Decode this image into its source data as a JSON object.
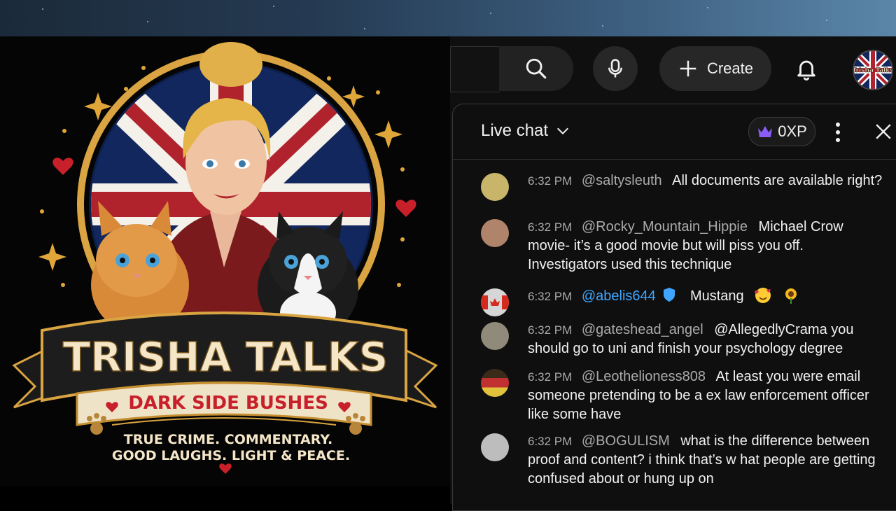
{
  "artwork": {
    "title": "TRISHA TALKS",
    "subtitle": "DARK SIDE BUSHES",
    "tagline_1": "TRUE CRIME. COMMENTARY.",
    "tagline_2": "GOOD LAUGHS. LIGHT & PEACE."
  },
  "header": {
    "create_label": "Create",
    "avatar_text": "Trisha Talks"
  },
  "icons": {
    "search": "search-icon",
    "mic": "mic-icon",
    "plus": "plus-icon",
    "bell": "bell-icon",
    "chevron": "chevron-down-icon",
    "crown": "crown-icon",
    "more": "more-vert-icon",
    "close": "close-icon",
    "verified": "verified-shield-icon"
  },
  "chat": {
    "title": "Live chat",
    "xp_label": "0XP",
    "messages": [
      {
        "time": "6:32 PM",
        "author": "@saltysleuth",
        "text": "All documents are available right?",
        "avatar_color": "#c9b56a"
      },
      {
        "time": "6:32 PM",
        "author": "@Rocky_Mountain_Hippie",
        "text": "Michael Crow movie- it’s a good movie but will piss you off. Investigators used this technique",
        "avatar_color": "#b0846a"
      },
      {
        "time": "6:32 PM",
        "author": "@abelis644",
        "text": "Mustang",
        "avatar_color": "#d6d6d6",
        "verified": true
      },
      {
        "time": "6:32 PM",
        "author": "@gateshead_angel",
        "text": "@AllegedlyCrama you should go to uni and finish your psychology degree",
        "avatar_color": "#8f8a7a"
      },
      {
        "time": "6:32 PM",
        "author": "@Leothelioness808",
        "text": "At least you were email someone pretending to be a ex law enforcement officer like some have",
        "avatar_color": "#c03030"
      },
      {
        "time": "6:32 PM",
        "author": "@BOGULISM",
        "text": "what is the difference between proof and content? i think that’s w hat people are getting confused about or hung up on",
        "avatar_color": "#bdbdbd"
      }
    ]
  },
  "colors": {
    "accent_blue": "#3ea6ff",
    "chat_bg": "#0f0f0f",
    "crown": "#8a5cf6",
    "title_cream": "#f5e6c8",
    "subtitle_red": "#c8202a",
    "gold": "#d9a441"
  }
}
